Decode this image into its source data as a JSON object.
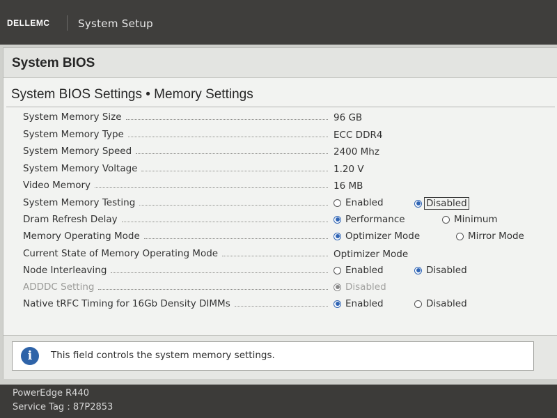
{
  "header": {
    "brand": "DELLEMC",
    "title": "System Setup"
  },
  "section_title": "System BIOS",
  "page_heading": "System BIOS Settings • Memory Settings",
  "rows": [
    {
      "label": "System Memory Size",
      "value": "96 GB"
    },
    {
      "label": "System Memory Type",
      "value": "ECC DDR4"
    },
    {
      "label": "System Memory Speed",
      "value": "2400 Mhz"
    },
    {
      "label": "System Memory Voltage",
      "value": "1.20 V"
    },
    {
      "label": "Video Memory",
      "value": "16 MB"
    },
    {
      "label": "System Memory Testing",
      "options": [
        "Enabled",
        "Disabled"
      ],
      "selected": "Disabled"
    },
    {
      "label": "Dram Refresh Delay",
      "options": [
        "Performance",
        "Minimum"
      ],
      "selected": "Performance"
    },
    {
      "label": "Memory Operating Mode",
      "options": [
        "Optimizer Mode",
        "Mirror Mode"
      ],
      "selected": "Optimizer Mode"
    },
    {
      "label": "Current State of Memory Operating Mode",
      "value": "Optimizer Mode"
    },
    {
      "label": "Node Interleaving",
      "options": [
        "Enabled",
        "Disabled"
      ],
      "selected": "Disabled"
    },
    {
      "label": "ADDDC Setting",
      "options": [
        "Disabled"
      ],
      "selected": "Disabled",
      "disabled": true
    },
    {
      "label": "Native tRFC Timing for 16Gb Density DIMMs",
      "options": [
        "Enabled",
        "Disabled"
      ],
      "selected": "Enabled"
    }
  ],
  "help_text": "This field controls the system memory settings.",
  "footer": {
    "model": "PowerEdge R440",
    "service_tag": "Service Tag : 87P2853"
  },
  "colors": {
    "topbar": "#3f3e3c",
    "radio_selected": "#2f64b4",
    "info_icon": "#2e63a8"
  }
}
